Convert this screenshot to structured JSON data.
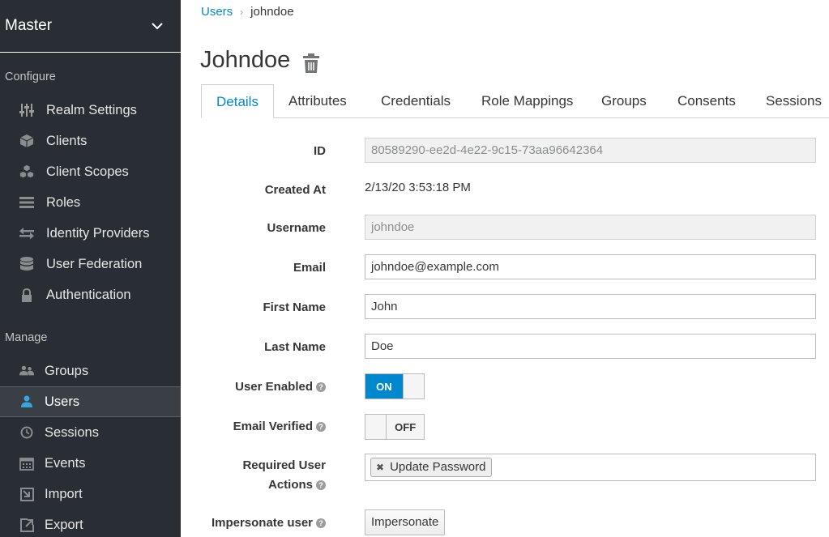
{
  "sidebar": {
    "realm": "Master",
    "configure_label": "Configure",
    "manage_label": "Manage",
    "configure_items": [
      {
        "label": "Realm Settings",
        "icon": "sliders-icon"
      },
      {
        "label": "Clients",
        "icon": "cube-icon"
      },
      {
        "label": "Client Scopes",
        "icon": "cubes-icon"
      },
      {
        "label": "Roles",
        "icon": "list-icon"
      },
      {
        "label": "Identity Providers",
        "icon": "exchange-icon"
      },
      {
        "label": "User Federation",
        "icon": "database-icon"
      },
      {
        "label": "Authentication",
        "icon": "lock-icon"
      }
    ],
    "manage_items": [
      {
        "label": "Groups",
        "icon": "users-icon"
      },
      {
        "label": "Users",
        "icon": "user-icon",
        "active": true
      },
      {
        "label": "Sessions",
        "icon": "clock-icon"
      },
      {
        "label": "Events",
        "icon": "calendar-icon"
      },
      {
        "label": "Import",
        "icon": "import-icon"
      },
      {
        "label": "Export",
        "icon": "export-icon"
      }
    ]
  },
  "breadcrumb": {
    "parent": "Users",
    "separator": "›",
    "current": "johndoe"
  },
  "page_title": "Johndoe",
  "tabs": [
    "Details",
    "Attributes",
    "Credentials",
    "Role Mappings",
    "Groups",
    "Consents",
    "Sessions"
  ],
  "form": {
    "id": {
      "label": "ID",
      "value": "80589290-ee2d-4e22-9c15-73aa96642364"
    },
    "created_at": {
      "label": "Created At",
      "value": "2/13/20 3:53:18 PM"
    },
    "username": {
      "label": "Username",
      "value": "johndoe"
    },
    "email": {
      "label": "Email",
      "value": "johndoe@example.com"
    },
    "first_name": {
      "label": "First Name",
      "value": "John"
    },
    "last_name": {
      "label": "Last Name",
      "value": "Doe"
    },
    "user_enabled": {
      "label": "User Enabled",
      "state": "ON"
    },
    "email_verified": {
      "label": "Email Verified",
      "state": "OFF"
    },
    "required_actions": {
      "label_line1": "Required User",
      "label_line2": "Actions",
      "tag": "Update Password"
    },
    "impersonate": {
      "label": "Impersonate user",
      "button": "Impersonate"
    }
  },
  "colors": {
    "sidebar_bg": "#292e34",
    "accent": "#0088ce"
  }
}
